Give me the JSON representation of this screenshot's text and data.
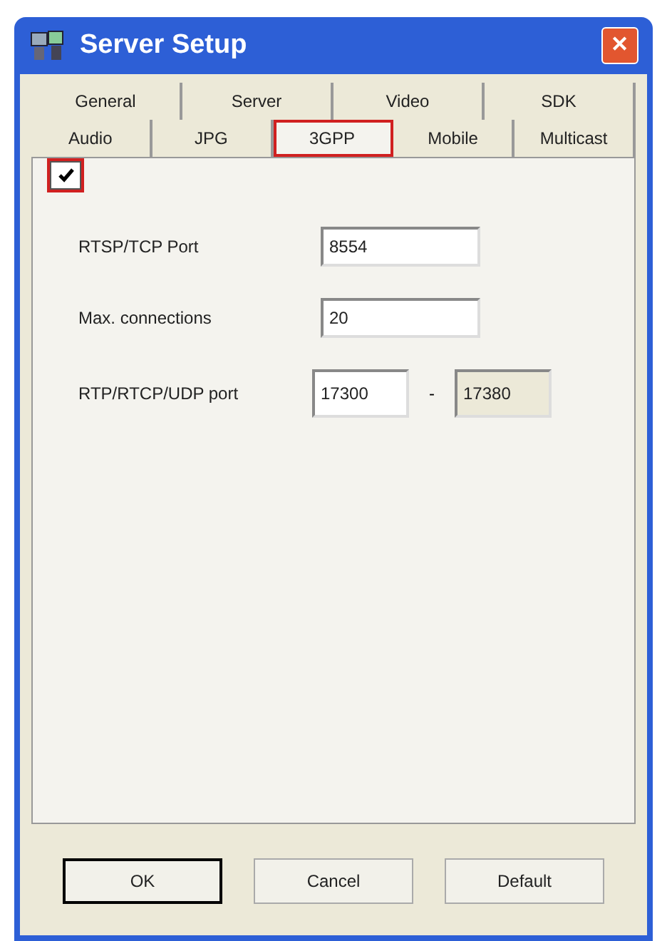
{
  "window": {
    "title": "Server Setup",
    "close": "✕"
  },
  "tab_rows": [
    [
      {
        "label": "General",
        "selected": false,
        "highlighted": false
      },
      {
        "label": "Server",
        "selected": false,
        "highlighted": false
      },
      {
        "label": "Video",
        "selected": false,
        "highlighted": false
      },
      {
        "label": "SDK",
        "selected": false,
        "highlighted": false
      }
    ],
    [
      {
        "label": "Audio",
        "selected": false,
        "highlighted": false
      },
      {
        "label": "JPG",
        "selected": false,
        "highlighted": false
      },
      {
        "label": "3GPP",
        "selected": true,
        "highlighted": true
      },
      {
        "label": "Mobile",
        "selected": false,
        "highlighted": false
      },
      {
        "label": "Multicast",
        "selected": false,
        "highlighted": false
      }
    ]
  ],
  "enable_checkbox": {
    "checked": true,
    "highlighted": true
  },
  "fields": [
    {
      "label": "RTSP/TCP Port",
      "values": [
        {
          "value": "8554",
          "disabled": false
        }
      ]
    },
    {
      "label": "Max. connections",
      "values": [
        {
          "value": "20",
          "disabled": false
        }
      ]
    },
    {
      "label": "RTP/RTCP/UDP port",
      "values": [
        {
          "value": "17300",
          "disabled": false
        },
        {
          "value": "17380",
          "disabled": true
        }
      ],
      "separator": "-"
    }
  ],
  "buttons": [
    {
      "label": "OK",
      "default": true
    },
    {
      "label": "Cancel",
      "default": false
    },
    {
      "label": "Default",
      "default": false
    }
  ]
}
